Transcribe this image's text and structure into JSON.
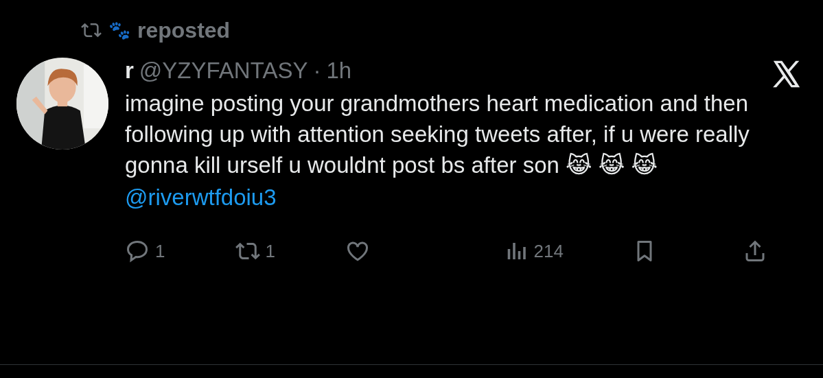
{
  "repost_header": {
    "name": "🐾",
    "label": "reposted"
  },
  "post": {
    "display_name": "r",
    "handle": "@YZYFANTASY",
    "separator": "·",
    "time": "1h",
    "text": "imagine posting your grandmothers heart medication and then following up with attention seeking tweets after, if u were really gonna kill urself u wouldnt post bs after son 😹 😹 😹",
    "mention": "@riverwtfdoiu3"
  },
  "actions": [
    {
      "kind": "reply",
      "count": "1"
    },
    {
      "kind": "repost",
      "count": "1"
    },
    {
      "kind": "like"
    },
    {
      "kind": "views",
      "count": "214"
    },
    {
      "kind": "bookmark"
    },
    {
      "kind": "share"
    }
  ]
}
